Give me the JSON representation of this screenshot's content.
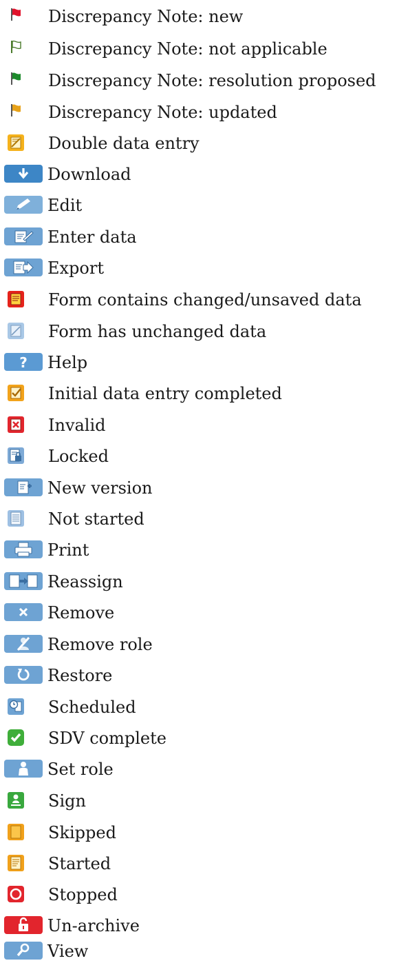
{
  "legend": {
    "items": [
      {
        "label": "Discrepancy Note: new",
        "icon": "red-flag-icon",
        "color": "#e1122b"
      },
      {
        "label": "Discrepancy Note: not applicable",
        "icon": "white-flag-icon",
        "color": "#4a7a2a"
      },
      {
        "label": "Discrepancy Note: resolution proposed",
        "icon": "green-flag-icon",
        "color": "#1d8a2c"
      },
      {
        "label": "Discrepancy Note: updated",
        "icon": "yellow-flag-icon",
        "color": "#e7a21a"
      },
      {
        "label": "Double data entry",
        "icon": "double-data-entry-icon",
        "color": "#f5b21c"
      },
      {
        "label": "Download",
        "icon": "download-icon",
        "color": "#3d86c6"
      },
      {
        "label": "Edit",
        "icon": "pencil-icon",
        "color": "#7fb0da"
      },
      {
        "label": "Enter data",
        "icon": "enter-data-icon",
        "color": "#6ea3d3"
      },
      {
        "label": "Export",
        "icon": "export-icon",
        "color": "#6ea3d3"
      },
      {
        "label": "Form contains changed/unsaved data",
        "icon": "form-unsaved-icon",
        "color": "#e5231b"
      },
      {
        "label": "Form has unchanged data",
        "icon": "form-unchanged-icon",
        "color": "#a9c8e6"
      },
      {
        "label": "Help",
        "icon": "help-icon",
        "color": "#5b9ad3"
      },
      {
        "label": "Initial data entry completed",
        "icon": "initial-entry-complete-icon",
        "color": "#f2a31b"
      },
      {
        "label": "Invalid",
        "icon": "invalid-icon",
        "color": "#e2252d"
      },
      {
        "label": "Locked",
        "icon": "lock-icon",
        "color": "#7eaad6"
      },
      {
        "label": "New version",
        "icon": "new-version-icon",
        "color": "#6ea3d3"
      },
      {
        "label": "Not started",
        "icon": "not-started-icon",
        "color": "#9ec0e3"
      },
      {
        "label": "Print",
        "icon": "printer-icon",
        "color": "#6ea3d3"
      },
      {
        "label": "Reassign",
        "icon": "reassign-icon",
        "color": "#6ea3d3"
      },
      {
        "label": "Remove",
        "icon": "remove-icon",
        "color": "#6ea3d3"
      },
      {
        "label": "Remove role",
        "icon": "remove-role-icon",
        "color": "#6ea3d3"
      },
      {
        "label": "Restore",
        "icon": "restore-icon",
        "color": "#6ea3d3"
      },
      {
        "label": "Scheduled",
        "icon": "clock-icon",
        "color": "#6ea3d3"
      },
      {
        "label": "SDV complete",
        "icon": "check-icon",
        "color": "#3fae3a"
      },
      {
        "label": "Set role",
        "icon": "person-icon",
        "color": "#6ea3d3"
      },
      {
        "label": "Sign",
        "icon": "sign-icon",
        "color": "#39a83e"
      },
      {
        "label": "Skipped",
        "icon": "skipped-icon",
        "color": "#f1a11b"
      },
      {
        "label": "Started",
        "icon": "started-icon",
        "color": "#f1a11b"
      },
      {
        "label": "Stopped",
        "icon": "stop-icon",
        "color": "#e2252d"
      },
      {
        "label": "Un-archive",
        "icon": "unlock-icon",
        "color": "#e2252d"
      },
      {
        "label": "View",
        "icon": "magnifier-icon",
        "color": "#6ea3d3"
      }
    ]
  }
}
